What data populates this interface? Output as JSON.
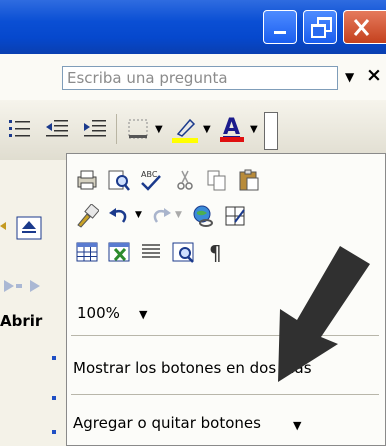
{
  "ask_box": {
    "placeholder": "Escriba una pregunta"
  },
  "side_fragment": {
    "label": "Abrir"
  },
  "toolbar_options_menu": {
    "zoom_value": "100%",
    "show_two_rows_item": "Mostrar los botones en dos filas",
    "add_remove_buttons_item": "Agregar o quitar botones"
  },
  "colors": {
    "title_bar": "#0a4fd4",
    "highlight_yellow": "#ffff00",
    "font_color_red": "#e01010",
    "menu_background": "#fcfcf9",
    "arrow": "#303030"
  }
}
